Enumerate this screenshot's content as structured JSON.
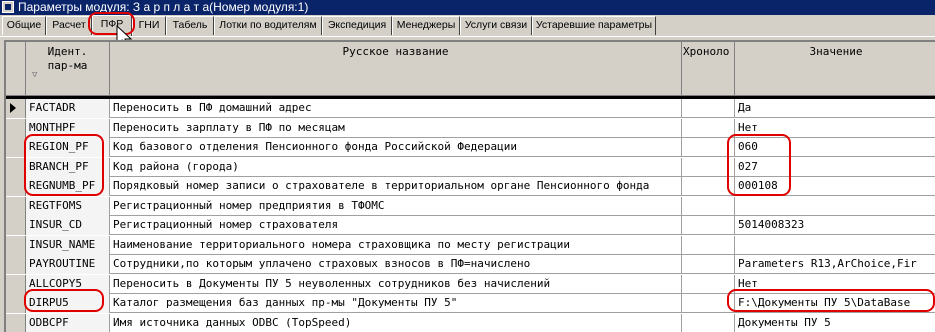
{
  "window": {
    "title": "Параметры модуля: З а р п л а т а(Номер модуля:1)"
  },
  "tabs": [
    "Общие",
    "Расчет",
    "ПФР",
    "ГНИ",
    "Табель",
    "Лотки по водителям",
    "Экспедиция",
    "Менеджеры",
    "Услуги связи",
    "Устаревшие параметры"
  ],
  "active_tab": "ПФР",
  "grid": {
    "columns": [
      "Идент.\nпар-ма",
      "Русское название",
      "Хроноло",
      "Значение"
    ],
    "rows": [
      {
        "id": "FACTADR",
        "name": "Переносить в ПФ домашний адрес",
        "value": "Да"
      },
      {
        "id": "MONTHPF",
        "name": "Переносить зарплату в ПФ по месяцам",
        "value": "Нет"
      },
      {
        "id": "REGION_PF",
        "name": "Код базового отделения Пенсионного фонда Российской Федерации",
        "value": "060"
      },
      {
        "id": "BRANCH_PF",
        "name": "Код района (города)",
        "value": "027"
      },
      {
        "id": "REGNUMB_PF",
        "name": "Порядковый номер записи о страхователе в территориальном органе Пенсионного фонда",
        "value": "000108"
      },
      {
        "id": "REGTFOMS",
        "name": "Регистрационный номер предприятия в ТФОМС",
        "value": ""
      },
      {
        "id": "INSUR_CD",
        "name": "Регистрационный номер страхователя",
        "value": "5014008323"
      },
      {
        "id": "INSUR_NAME",
        "name": "Наименование территориального номера страховщика по месту регистрации",
        "value": ""
      },
      {
        "id": "PAYROUTINE",
        "name": "Сотрудники,по которым уплачено страховых взносов в ПФ=начислено",
        "value": "Parameters R13,ArChoice,Fir"
      },
      {
        "id": "ALLCOPY5",
        "name": "Переносить в Документы ПУ 5 неуволенных сотрудников без начислений",
        "value": "Нет"
      },
      {
        "id": "DIRPU5",
        "name": "Каталог размещения баз данных пр-мы \"Документы ПУ 5\"",
        "value": "F:\\Документы ПУ 5\\DataBase"
      },
      {
        "id": "ODBCPF",
        "name": "Имя источника данных ODBC (TopSpeed)",
        "value": "Документы ПУ 5"
      }
    ]
  }
}
